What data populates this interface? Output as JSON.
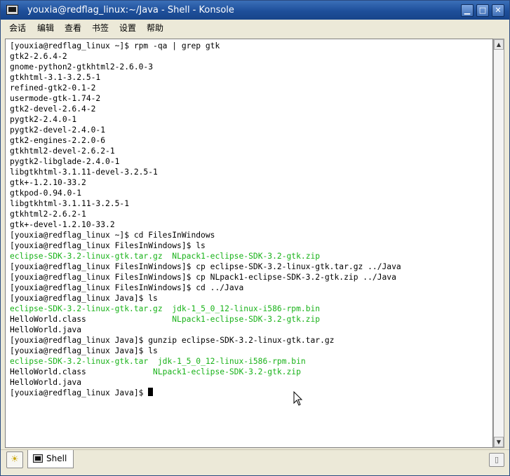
{
  "window": {
    "title": "youxia@redflag_linux:~/Java - Shell - Konsole",
    "icon": "terminal-icon"
  },
  "menubar": {
    "items": [
      {
        "label": "会话"
      },
      {
        "label": "编辑"
      },
      {
        "label": "查看"
      },
      {
        "label": "书签"
      },
      {
        "label": "设置"
      },
      {
        "label": "帮助"
      }
    ]
  },
  "terminal": {
    "text_color": "#000000",
    "highlight_color": "#18b218",
    "lines": [
      [
        {
          "t": "[youxia@redflag_linux ~]$ rpm -qa | grep gtk"
        }
      ],
      [
        {
          "t": "gtk2-2.6.4-2"
        }
      ],
      [
        {
          "t": "gnome-python2-gtkhtml2-2.6.0-3"
        }
      ],
      [
        {
          "t": "gtkhtml-3.1-3.2.5-1"
        }
      ],
      [
        {
          "t": "refined-gtk2-0.1-2"
        }
      ],
      [
        {
          "t": "usermode-gtk-1.74-2"
        }
      ],
      [
        {
          "t": "gtk2-devel-2.6.4-2"
        }
      ],
      [
        {
          "t": "pygtk2-2.4.0-1"
        }
      ],
      [
        {
          "t": "pygtk2-devel-2.4.0-1"
        }
      ],
      [
        {
          "t": "gtk2-engines-2.2.0-6"
        }
      ],
      [
        {
          "t": "gtkhtml2-devel-2.6.2-1"
        }
      ],
      [
        {
          "t": "pygtk2-libglade-2.4.0-1"
        }
      ],
      [
        {
          "t": "libgtkhtml-3.1.11-devel-3.2.5-1"
        }
      ],
      [
        {
          "t": "gtk+-1.2.10-33.2"
        }
      ],
      [
        {
          "t": "gtkpod-0.94.0-1"
        }
      ],
      [
        {
          "t": "libgtkhtml-3.1.11-3.2.5-1"
        }
      ],
      [
        {
          "t": "gtkhtml2-2.6.2-1"
        }
      ],
      [
        {
          "t": "gtk+-devel-1.2.10-33.2"
        }
      ],
      [
        {
          "t": "[youxia@redflag_linux ~]$ cd FilesInWindows"
        }
      ],
      [
        {
          "t": "[youxia@redflag_linux FilesInWindows]$ ls"
        }
      ],
      [
        {
          "t": "eclipse-SDK-3.2-linux-gtk.tar.gz",
          "g": true
        },
        {
          "t": "  "
        },
        {
          "t": "NLpack1-eclipse-SDK-3.2-gtk.zip",
          "g": true
        }
      ],
      [
        {
          "t": "[youxia@redflag_linux FilesInWindows]$ cp eclipse-SDK-3.2-linux-gtk.tar.gz ../Java"
        }
      ],
      [
        {
          "t": "[youxia@redflag_linux FilesInWindows]$ cp NLpack1-eclipse-SDK-3.2-gtk.zip ../Java"
        }
      ],
      [
        {
          "t": "[youxia@redflag_linux FilesInWindows]$ cd ../Java"
        }
      ],
      [
        {
          "t": "[youxia@redflag_linux Java]$ ls"
        }
      ],
      [
        {
          "t": "eclipse-SDK-3.2-linux-gtk.tar.gz",
          "g": true
        },
        {
          "t": "  "
        },
        {
          "t": "jdk-1_5_0_12-linux-i586-rpm.bin",
          "g": true
        }
      ],
      [
        {
          "t": "HelloWorld.class                  "
        },
        {
          "t": "NLpack1-eclipse-SDK-3.2-gtk.zip",
          "g": true
        }
      ],
      [
        {
          "t": "HelloWorld.java"
        }
      ],
      [
        {
          "t": "[youxia@redflag_linux Java]$ gunzip eclipse-SDK-3.2-linux-gtk.tar.gz"
        }
      ],
      [
        {
          "t": "[youxia@redflag_linux Java]$ ls"
        }
      ],
      [
        {
          "t": "eclipse-SDK-3.2-linux-gtk.tar",
          "g": true
        },
        {
          "t": "  "
        },
        {
          "t": "jdk-1_5_0_12-linux-i586-rpm.bin",
          "g": true
        }
      ],
      [
        {
          "t": "HelloWorld.class              "
        },
        {
          "t": "NLpack1-eclipse-SDK-3.2-gtk.zip",
          "g": true
        }
      ],
      [
        {
          "t": "HelloWorld.java"
        }
      ],
      [
        {
          "t": "[youxia@redflag_linux Java]$ "
        },
        {
          "cursor": true
        }
      ]
    ]
  },
  "tabbar": {
    "new_tab_icon": "new-session-icon",
    "tabs": [
      {
        "label": "Shell",
        "icon": "terminal-icon"
      }
    ],
    "close_icon": "close-session-icon"
  }
}
